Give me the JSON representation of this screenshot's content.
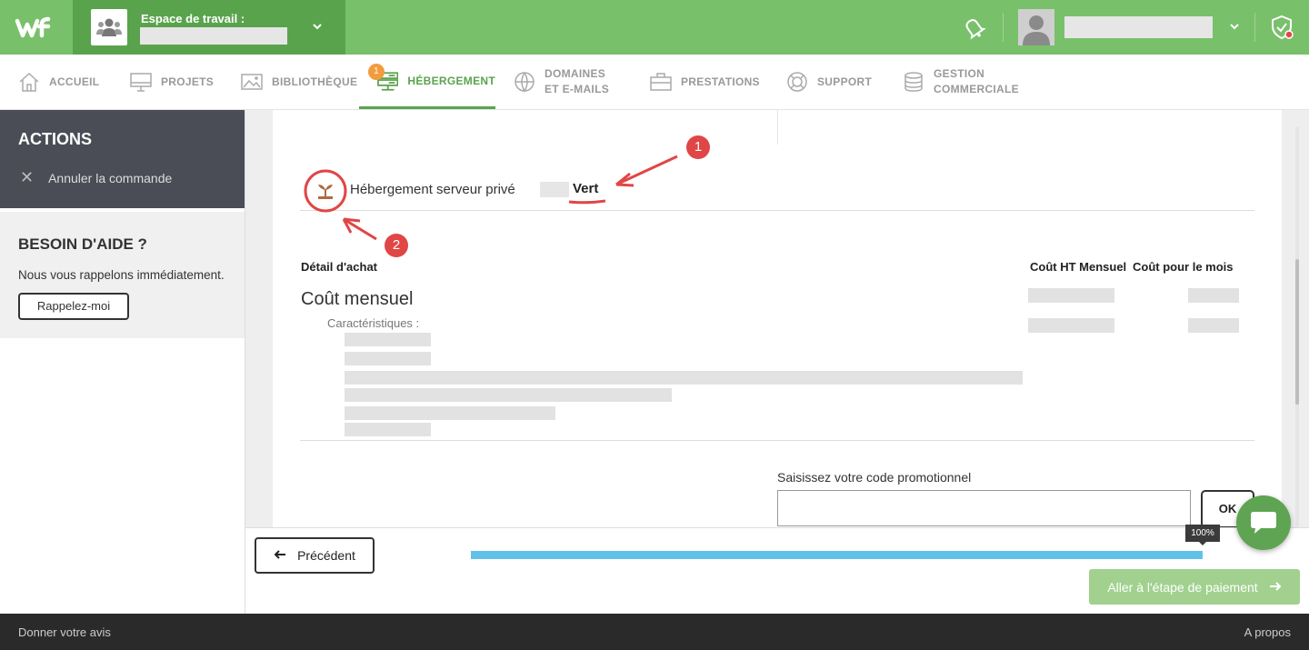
{
  "header": {
    "logo_text": "wf",
    "workspace_label": "Espace de travail :"
  },
  "nav": {
    "items": [
      {
        "label": "ACCUEIL"
      },
      {
        "label": "PROJETS"
      },
      {
        "label": "BIBLIOTHÈQUE"
      },
      {
        "label": "HÉBERGEMENT",
        "badge": "1",
        "active": true
      },
      {
        "label_line1": "DOMAINES",
        "label_line2": "ET E-MAILS"
      },
      {
        "label": "PRESTATIONS"
      },
      {
        "label": "SUPPORT"
      },
      {
        "label_line1": "GESTION",
        "label_line2": "COMMERCIALE"
      }
    ]
  },
  "sidebar": {
    "actions_title": "ACTIONS",
    "cancel_label": "Annuler la commande",
    "help_title": "BESOIN D'AIDE ?",
    "help_text": "Nous vous rappelons immédiatement.",
    "callback_label": "Rappelez-moi"
  },
  "main": {
    "product_title": "Hébergement serveur privé",
    "product_variant": "Vert",
    "col_detail": "Détail d'achat",
    "col_cost_ht": "Coût HT Mensuel",
    "col_cost_month": "Coût pour le mois",
    "monthly_cost": "Coût mensuel",
    "characteristics": "Caractéristiques :",
    "promo_label": "Saisissez votre code promotionnel",
    "promo_value": "",
    "ok_label": "OK"
  },
  "footer_actions": {
    "prev_label": "Précédent",
    "progress_percent": 100,
    "progress_label": "100%",
    "pay_label": "Aller à l'étape de paiement"
  },
  "annotations": {
    "one": "1",
    "two": "2"
  },
  "bottom": {
    "feedback": "Donner votre avis",
    "about": "A propos"
  },
  "colors": {
    "brand_green": "#79c06b",
    "progress_blue": "#62c1e8",
    "annotation_red": "#e04646",
    "badge_orange": "#f39c3d"
  }
}
